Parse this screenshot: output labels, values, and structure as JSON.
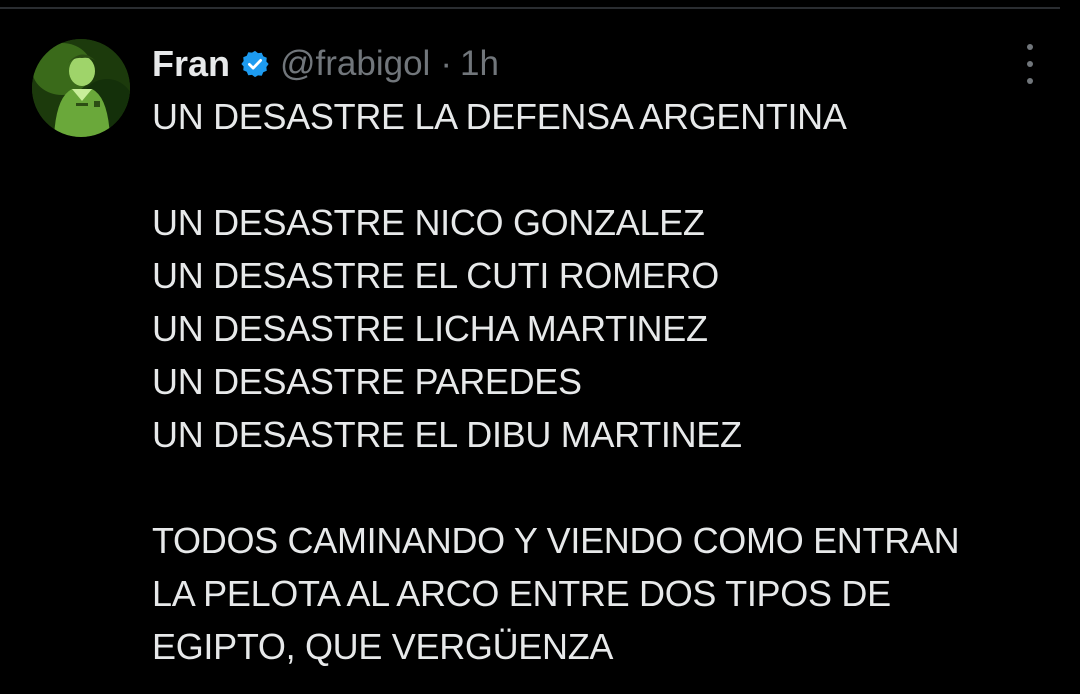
{
  "tweet": {
    "display_name": "Fran",
    "handle": "@frabigol",
    "separator": "·",
    "time": "1h",
    "verified_icon": "verified-badge-icon",
    "more_icon": "more-options-icon",
    "lines": [
      "UN DESASTRE LA DEFENSA ARGENTINA",
      "",
      "UN DESASTRE NICO GONZALEZ",
      "UN DESASTRE EL CUTI ROMERO",
      "UN DESASTRE LICHA MARTINEZ",
      "UN DESASTRE PAREDES",
      "UN DESASTRE EL DIBU MARTINEZ",
      "",
      "TODOS CAMINANDO Y VIENDO COMO ENTRAN",
      "LA PELOTA AL ARCO ENTRE DOS TIPOS DE",
      "EGIPTO, QUE VERGÜENZA"
    ]
  },
  "colors": {
    "background": "#000000",
    "text": "#e7e9ea",
    "secondary": "#71767b",
    "verified": "#1d9bf0"
  }
}
